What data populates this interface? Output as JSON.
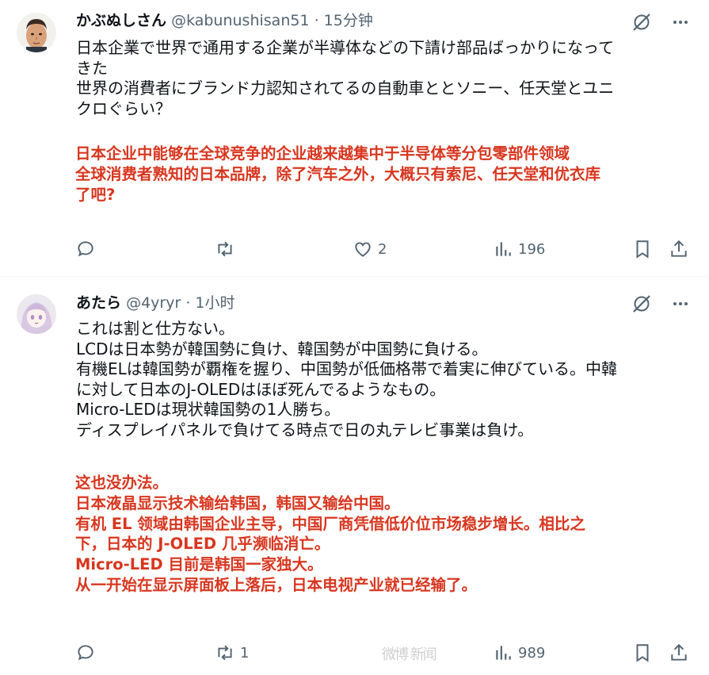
{
  "tweets": [
    {
      "author_name": "かぶぬしさん",
      "handle": "@kabunushisan51",
      "time": "· 15分钟",
      "text_lines": [
        "日本企業で世界で通用する企業が半導体などの下請け部品ばっかりになって",
        "きた",
        "世界の消費者にブランド力認知されてるの自動車ととソニー、任天堂とユニ",
        "クロぐらい？"
      ],
      "translation_lines": [
        "日本企业中能够在全球竞争的企业越来越集中于半导体等分包零部件领域",
        "全球消费者熟知的日本品牌，除了汽车之外，大概只有索尼、任天堂和优衣库",
        "了吧?"
      ],
      "reply_count": "",
      "retweet_count": "",
      "like_count": "2",
      "view_count": "196"
    },
    {
      "author_name": "あたら",
      "handle": "@4yryr",
      "time": "· 1小时",
      "text_lines": [
        "これは割と仕方ない。",
        "LCDは日本勢が韓国勢に負け、韓国勢が中国勢に負ける。",
        "有機ELは韓国勢が覇権を握り、中国勢が低価格帯で着実に伸びている。中韓",
        "に対して日本のJ-OLEDはほぼ死んでるようなもの。",
        "Micro-LEDは現状韓国勢の1人勝ち。",
        "ディスプレイパネルで負けてる時点で日の丸テレビ事業は負け。"
      ],
      "translation_lines": [
        "这也没办法。",
        "日本液晶显示技术输给韩国，韩国又输给中国。",
        "有机 EL 领域由韩国企业主导，中国厂商凭借低价位市场稳步增长。相比之",
        "下，日本的 J-OLED 几乎濒临消亡。",
        "Micro-LED 目前是韩国一家独大。",
        "从一开始在显示屏面板上落后，日本电视产业就已经输了。"
      ],
      "reply_count": "",
      "retweet_count": "1",
      "like_count": "",
      "view_count": "989"
    }
  ],
  "watermark": "微博 新闻"
}
